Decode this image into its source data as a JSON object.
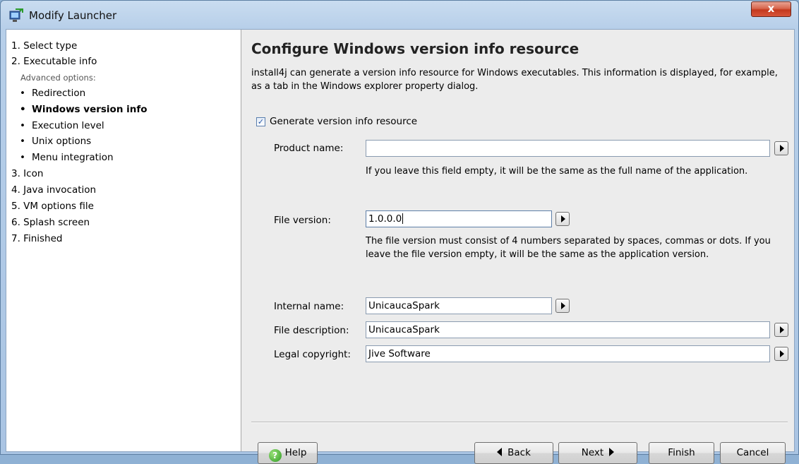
{
  "window": {
    "title": "Modify Launcher",
    "close_label": "x"
  },
  "sidebar": {
    "items": [
      {
        "label": "1. Select type"
      },
      {
        "label": "2. Executable info"
      },
      {
        "label": "Advanced options:"
      },
      {
        "label": "Redirection"
      },
      {
        "label": "Windows version info",
        "active": true
      },
      {
        "label": "Execution level"
      },
      {
        "label": "Unix options"
      },
      {
        "label": "Menu integration"
      },
      {
        "label": "3. Icon"
      },
      {
        "label": "4. Java invocation"
      },
      {
        "label": "5. VM options file"
      },
      {
        "label": "6. Splash screen"
      },
      {
        "label": "7. Finished"
      }
    ],
    "bullet": "•"
  },
  "main": {
    "heading": "Configure Windows version info resource",
    "intro": "install4j can generate a version info resource for Windows executables. This information is displayed, for example, as a tab in the Windows explorer property dialog.",
    "generate_checkbox": {
      "label": "Generate version info resource",
      "checked": true,
      "mark": "✓"
    },
    "product_name": {
      "label": "Product name:",
      "value": "",
      "help": "If you leave this field empty, it will be the same as the full name of the application."
    },
    "file_version": {
      "label": "File version:",
      "value": "1.0.0.0",
      "help": "The file version must consist of 4 numbers separated by spaces, commas or dots. If you leave the file version empty, it will be the same as the application version."
    },
    "internal_name": {
      "label": "Internal name:",
      "value": "UnicaucaSpark"
    },
    "file_description": {
      "label": "File description:",
      "value": "UnicaucaSpark"
    },
    "legal_copyright": {
      "label": "Legal copyright:",
      "value": "Jive Software"
    }
  },
  "footer": {
    "help_label": "Help",
    "help_icon_glyph": "?",
    "back_label": "Back",
    "next_label": "Next",
    "finish_label": "Finish",
    "cancel_label": "Cancel"
  }
}
